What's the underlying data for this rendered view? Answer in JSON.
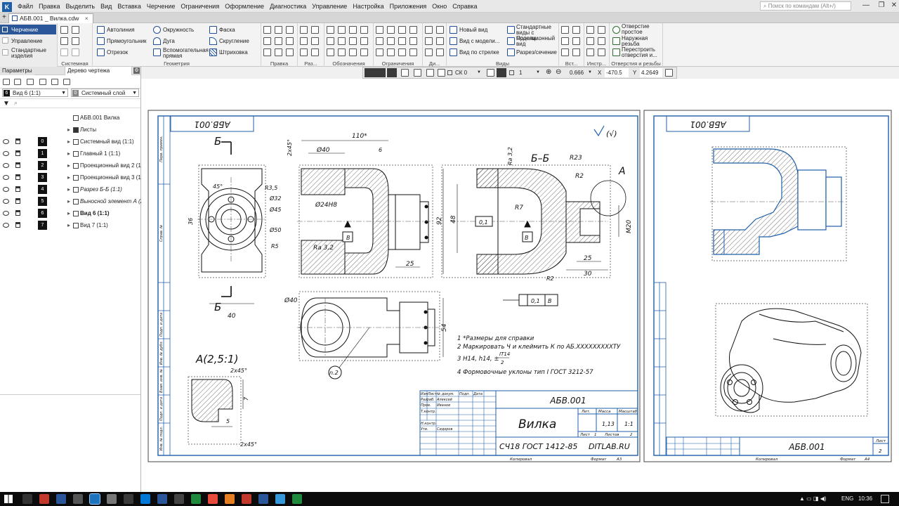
{
  "app": {
    "menu": [
      "Файл",
      "Правка",
      "Выделить",
      "Вид",
      "Вставка",
      "Черчение",
      "Ограничения",
      "Оформление",
      "Диагностика",
      "Управление",
      "Настройка",
      "Приложения",
      "Окно",
      "Справка"
    ],
    "search_placeholder": "Поиск по командам (Alt+/)",
    "document_tab": "АБВ.001 _ Вилка.cdw"
  },
  "ribbon": {
    "left_items": [
      "Черчение",
      "Управление",
      "Стандартные изделия"
    ],
    "system_caption": "Системная",
    "geometry": {
      "caption": "Геометрия",
      "items": [
        "Автолиния",
        "Окружность",
        "Фаска",
        "Прямоугольник",
        "Дуга",
        "Скругление",
        "Отрезок",
        "Вспомогательная прямая",
        "Штриховка"
      ]
    },
    "captions": [
      "Правка",
      "Раз...",
      "Обозначения",
      "Ограничения",
      "Ди...",
      "Виды",
      "Вст...",
      "Инстр...",
      "Отверстия и резьбы"
    ],
    "views": [
      "Новый вид",
      "Стандартные виды с модели...",
      "Вид с модели...",
      "Проекционный вид",
      "Вид по стрелке",
      "Разрез/сечение"
    ],
    "holes": [
      "Отверстие простое",
      "Наружная резьба",
      "Перестроить отверстия и..."
    ]
  },
  "left_panel": {
    "tabs": [
      "Параметры",
      "Дерево чертежа"
    ],
    "view_select": "Вид 6 (1:1)",
    "view_number": "6",
    "layer_select": "Системный слой",
    "layer_number": "0",
    "root": "АБВ.001 Вилка",
    "sheets": "Листы",
    "tree": [
      {
        "layer": "0",
        "name": "Системный вид (1:1)"
      },
      {
        "layer": "1",
        "name": "Главный 1 (1:1)"
      },
      {
        "layer": "2",
        "name": "Проекционный вид 2 (1"
      },
      {
        "layer": "3",
        "name": "Проекционный вид 3 (1"
      },
      {
        "layer": "4",
        "name": "Разрез Б-Б (1:1)"
      },
      {
        "layer": "5",
        "name": "Выносной элемент А (2"
      },
      {
        "layer": "6",
        "name": "Вид 6 (1:1)"
      },
      {
        "layer": "7",
        "name": "Вид 7 (1:1)"
      }
    ]
  },
  "drawing_toolbar": {
    "coordsys": "СК 0",
    "step": "1",
    "zoom": "0.666",
    "x_label": "X",
    "x_value": "-470.5",
    "y_label": "Y",
    "y_value": "4.2649"
  },
  "drawing": {
    "sheet1": {
      "stamp_code": "АБВ.001",
      "section_label": "Б",
      "section_title": "Б–Б",
      "detail_label": "А",
      "detail_title": "A(2,5:1)",
      "dims": {
        "d110": "110*",
        "d40": "Ø40",
        "d6": "6",
        "d2x45": "2x45°",
        "d24H8": "Ø24H8",
        "ra32": "Ra 3,2",
        "d25": "25",
        "d92": "92",
        "d48": "48",
        "d45deg": "45°",
        "r35": "R3,5",
        "o32": "Ø32",
        "o45": "Ø45",
        "o50": "Ø50",
        "r5": "R5",
        "d36": "36",
        "d40b": "40",
        "r23": "R23",
        "r2": "R2",
        "r7": "R7",
        "m20": "M20",
        "d30": "30",
        "b": "В",
        "tol": "0,1",
        "d54": "54",
        "n2": "n.2",
        "d7": "7",
        "d5": "5",
        "d2x45b": "2x45°"
      },
      "notes": [
        "1  *Размеры для справки",
        "2  Маркировать Ч и клеймить К по АБ.XXXXXXXXXТУ",
        "3  H14, h14, ±",
        "4  Формовочные уклоны тип I ГОСТ 3212-57"
      ],
      "note_frac": [
        "IT14",
        "2"
      ],
      "title_block": {
        "code": "АБВ.001",
        "name": "Вилка",
        "material": "СЧ18  ГОСТ 1412-85",
        "org": "DITLAB.RU",
        "mass": "1,13",
        "scale": "1:1",
        "headers": [
          "Лит.",
          "Масса",
          "Масштаб"
        ],
        "sheet_row": [
          "Лист",
          "1",
          "Листов",
          "2"
        ],
        "left_rows": [
          "Изм",
          "Лист",
          "№ докум.",
          "Подп.",
          "Дата",
          "Разраб.",
          "Алексей",
          "Пров.",
          "Иванов",
          "Т.контр.",
          "Н.контр.",
          "Утв.",
          "Сидоров"
        ],
        "copy": "Копировал",
        "format": "Формат",
        "format_value": "А3"
      },
      "roughness": "(√)"
    },
    "sheet2": {
      "stamp_code": "АБВ.001",
      "title_code": "АБВ.001",
      "sheet_no": "2",
      "sheet_label": "Лист",
      "copy": "Копировал",
      "format": "Формат",
      "format_value": "А4"
    },
    "side_strip": [
      "Перв. примен.",
      "Справ. №",
      "Подп. и дата",
      "Инв. № дубл.",
      "Взам. инв. №",
      "Подп. и дата",
      "Инв. № подл."
    ]
  },
  "taskbar": {
    "lang": "ENG",
    "time": "10:36"
  }
}
